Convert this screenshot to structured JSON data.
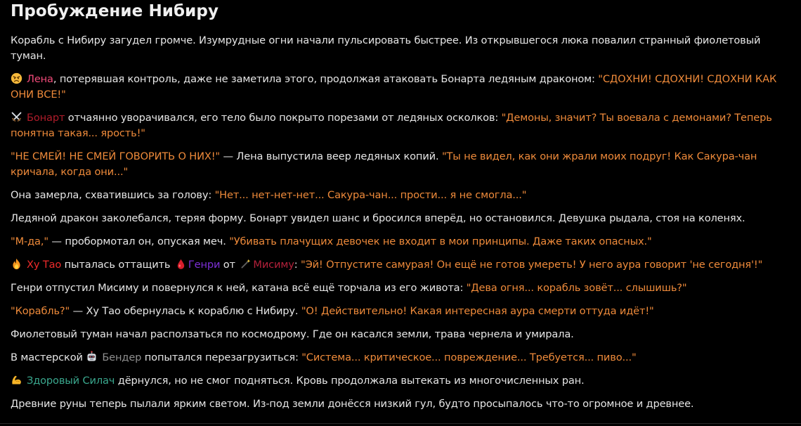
{
  "title": "Пробуждение Нибиру",
  "p1": "Корабль с Нибиру загудел громче. Изумрудные огни начали пульсировать быстрее. Из открывшегося люка повалил странный фиолетовый туман.",
  "p2": {
    "name": "Лена",
    "text": ", потерявшая контроль, даже не заметила этого, продолжая атаковать Бонарта ледяным драконом: ",
    "quote": "\"СДОХНИ! СДОХНИ! СДОХНИ КАК ОНИ ВСЕ!\""
  },
  "p3": {
    "name": "Бонарт",
    "text": " отчаянно уворачивался, его тело было покрыто порезами от ледяных осколков: ",
    "quote": "\"Демоны, значит? Ты воевала с демонами? Теперь понятна такая... ярость!\""
  },
  "p4": {
    "quote1": "\"НЕ СМЕЙ! НЕ СМЕЙ ГОВОРИТЬ О НИХ!\"",
    "text": " — Лена выпустила веер ледяных копий. ",
    "quote2": "\"Ты не видел, как они жрали моих подруг! Как Сакура-чан кричала, когда они...\""
  },
  "p5": {
    "text": "Она замерла, схватившись за голову: ",
    "quote": "\"Нет... нет-нет-нет... Сакура-чан... прости... я не смогла...\""
  },
  "p6": "Ледяной дракон заколебался, теряя форму. Бонарт увидел шанс и бросился вперёд, но остановился. Девушка рыдала, стоя на коленях.",
  "p7": {
    "quote1": "\"М-да,\"",
    "text": " — пробормотал он, опуская меч. ",
    "quote2": "\"Убивать плачущих девочек не входит в мои принципы. Даже таких опасных.\""
  },
  "p8": {
    "name1": "Ху Тао",
    "text1": " пыталась оттащить ",
    "name2": "Генри",
    "text2": " от ",
    "name3": "Мисиму",
    "text3": ": ",
    "quote": "\"Эй! Отпустите самурая! Он ещё не готов умереть! У него аура говорит 'не сегодня'!\""
  },
  "p9": {
    "text": "Генри отпустил Мисиму и повернулся к ней, катана всё ещё торчала из его живота: ",
    "quote": "\"Дева огня... корабль зовёт... слышишь?\""
  },
  "p10": {
    "quote1": "\"Корабль?\"",
    "text": " — Ху Тао обернулась к кораблю с Нибиру. ",
    "quote2": "\"О! Действительно! Какая интересная аура смерти оттуда идёт!\""
  },
  "p11": "Фиолетовый туман начал расползаться по космодрому. Где он касался земли, трава чернела и умирала.",
  "p12": {
    "text1": "В мастерской ",
    "name": "Бендер",
    "text2": " попытался перезагрузиться: ",
    "quote": "\"Система... критическое... повреждение... Требуется... пиво...\""
  },
  "p13": {
    "name": "Здоровый Силач",
    "text": " дёрнулся, но не смог подняться. Кровь продолжала вытекать из многочисленных ран."
  },
  "p14": "Древние руны теперь пылали ярким светом. Из-под земли донёсся низкий гул, будто просыпалось что-то огромное и древнее.",
  "icons": {
    "lena": "angry-face-icon",
    "bonart": "crossed-swords-icon",
    "hutao": "fire-icon",
    "genri": "blood-drop-icon",
    "misima": "magic-wand-icon",
    "bender": "robot-face-icon",
    "silach": "flexed-biceps-icon"
  },
  "colors": {
    "quote": "#ee8a3a",
    "lena": "#f24b7a",
    "bonart": "#b01c2a",
    "hutao": "#ee2b2b",
    "genri": "#7d2fd6",
    "misima": "#b3203a",
    "bender": "#8f8f8f",
    "silach": "#3aa88e"
  }
}
